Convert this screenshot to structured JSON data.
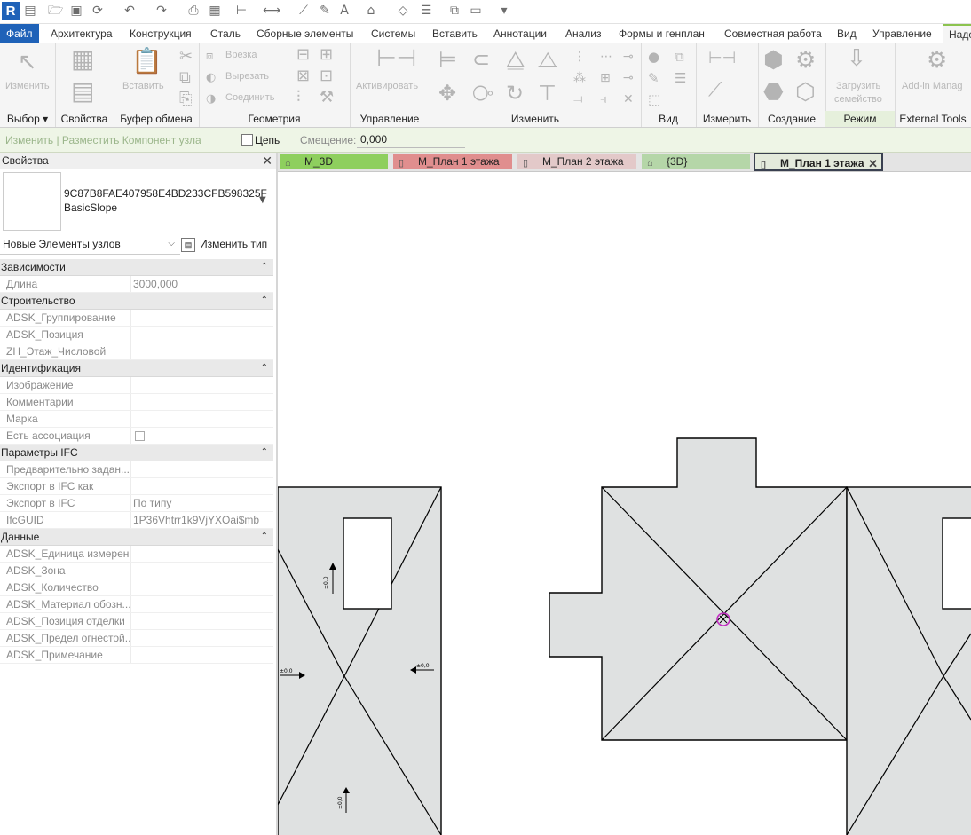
{
  "app": {
    "logo": "R"
  },
  "tabs": [
    {
      "label": "Файл"
    },
    {
      "label": "Архитектура"
    },
    {
      "label": "Конструкция"
    },
    {
      "label": "Сталь"
    },
    {
      "label": "Сборные элементы"
    },
    {
      "label": "Системы"
    },
    {
      "label": "Вставить"
    },
    {
      "label": "Аннотации"
    },
    {
      "label": "Анализ"
    },
    {
      "label": "Формы и генплан"
    },
    {
      "label": "Совместная работа"
    },
    {
      "label": "Вид"
    },
    {
      "label": "Управление"
    },
    {
      "label": "Надс"
    }
  ],
  "ribbon": {
    "modify": {
      "label": "Изменить",
      "title": "Выбор ▾"
    },
    "properties": {
      "title": "Свойства"
    },
    "clipboard": {
      "paste": "Вставить",
      "title": "Буфер обмена"
    },
    "geometry": {
      "cut": "Врезка",
      "unjoin": "Вырезать",
      "join": "Соединить",
      "title": "Геометрия"
    },
    "control": {
      "activate": "Активировать",
      "title": "Управление"
    },
    "modify_panel": {
      "title": "Изменить"
    },
    "view": {
      "title": "Вид"
    },
    "measure": {
      "title": "Измерить"
    },
    "create": {
      "title": "Создание"
    },
    "mode": {
      "load_line1": "Загрузить",
      "load_line2": "семейство",
      "title": "Режим"
    },
    "external": {
      "addin": "Add-in Manag",
      "title": "External Tools"
    }
  },
  "options_bar": {
    "context": "Изменить | Разместить Компонент узла",
    "chain_label": "Цепь",
    "offset_label": "Смещение:",
    "offset_value": "0,000"
  },
  "properties": {
    "title": "Свойства",
    "type_line1": "9C87B8FAE407958E4BD233CFB598325F",
    "type_line2": "BasicSlope",
    "filter": "Новые Элементы узлов",
    "edit_type": "Изменить тип",
    "groups": [
      {
        "name": "Зависимости",
        "rows": [
          {
            "k": "Длина",
            "v": "3000,000"
          }
        ]
      },
      {
        "name": "Строительство",
        "rows": [
          {
            "k": "ADSK_Группирование",
            "v": ""
          },
          {
            "k": "ADSK_Позиция",
            "v": ""
          },
          {
            "k": "ZH_Этаж_Числовой",
            "v": ""
          }
        ]
      },
      {
        "name": "Идентификация",
        "rows": [
          {
            "k": "Изображение",
            "v": ""
          },
          {
            "k": "Комментарии",
            "v": ""
          },
          {
            "k": "Марка",
            "v": ""
          },
          {
            "k": "Есть ассоциация",
            "v": ""
          }
        ]
      },
      {
        "name": "Параметры IFC",
        "rows": [
          {
            "k": "Предварительно задан...",
            "v": ""
          },
          {
            "k": "Экспорт в IFC как",
            "v": ""
          },
          {
            "k": "Экспорт в IFC",
            "v": "По типу"
          },
          {
            "k": "IfcGUID",
            "v": "1P36Vhtrr1k9VjYXOai$mb"
          }
        ]
      },
      {
        "name": "Данные",
        "rows": [
          {
            "k": "ADSK_Единица измерен...",
            "v": ""
          },
          {
            "k": "ADSK_Зона",
            "v": ""
          },
          {
            "k": "ADSK_Количество",
            "v": ""
          },
          {
            "k": "ADSK_Материал обозн...",
            "v": ""
          },
          {
            "k": "ADSK_Позиция отделки",
            "v": ""
          },
          {
            "k": "ADSK_Предел огнестой...",
            "v": ""
          },
          {
            "k": "ADSK_Примечание",
            "v": ""
          }
        ]
      }
    ]
  },
  "view_tabs": [
    {
      "label": "М_3D",
      "color": "#8ecf5e"
    },
    {
      "label": "М_План 1 этажа",
      "color": "#e08e8e"
    },
    {
      "label": "М_План 2 этажа",
      "color": "#e3c9c9"
    },
    {
      "label": "{3D}",
      "color": "#b5d6a8"
    },
    {
      "label": "М_План 1 этажа",
      "color": "#e4eadc"
    }
  ],
  "canvas": {
    "roof_fill": "#dfe1e1",
    "marker_color": "#c02cc0",
    "slope_labels": [
      "±0,0",
      "±0,0",
      "±0,0",
      "±0,0"
    ]
  }
}
